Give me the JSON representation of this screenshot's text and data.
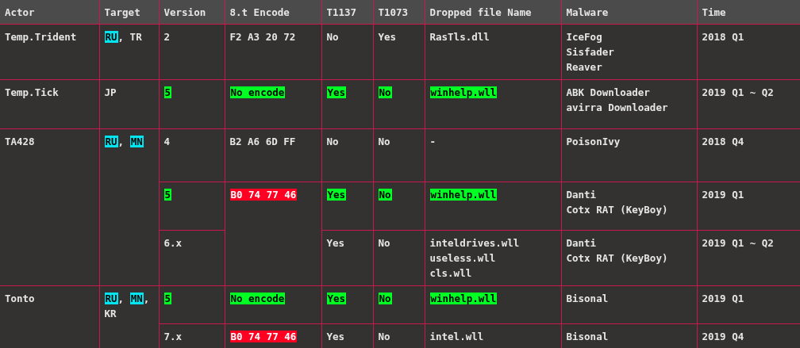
{
  "table": {
    "columns": [
      "Actor",
      "Target",
      "Version",
      "8.t Encode",
      "T1137",
      "T1073",
      "Dropped file Name",
      "Malware",
      "Time"
    ],
    "rows": [
      {
        "cells": [
          {
            "lines": [
              "Temp.Trident"
            ]
          },
          {
            "parts": [
              {
                "text": "RU",
                "color": "#00e5f0"
              },
              {
                "text": ", TR"
              }
            ]
          },
          {
            "lines": [
              "2"
            ]
          },
          {
            "lines": [
              "F2 A3 20 72"
            ]
          },
          {
            "lines": [
              "No"
            ]
          },
          {
            "lines": [
              "Yes"
            ]
          },
          {
            "lines": [
              "RasTls.dll"
            ]
          },
          {
            "lines": [
              "IceFog",
              "Sisfader",
              "Reaver"
            ]
          },
          {
            "lines": [
              "2018 Q1"
            ]
          }
        ]
      },
      {
        "cells": [
          {
            "lines": [
              "Temp.Tick"
            ]
          },
          {
            "lines": [
              "JP"
            ]
          },
          {
            "lines": [
              "5"
            ],
            "color": "#00ff22"
          },
          {
            "lines": [
              "No encode"
            ],
            "color": "#00ff22"
          },
          {
            "lines": [
              "Yes"
            ],
            "color": "#00ff22"
          },
          {
            "lines": [
              "No"
            ],
            "color": "#00ff22"
          },
          {
            "lines": [
              "winhelp.wll"
            ],
            "color": "#00ff22"
          },
          {
            "lines": [
              "ABK Downloader",
              "avirra Downloader"
            ]
          },
          {
            "lines": [
              "2019 Q1 ~ Q2"
            ]
          }
        ]
      },
      {
        "cells": [
          {
            "lines": [
              "TA428"
            ],
            "rowspan": 3
          },
          {
            "parts": [
              {
                "text": "RU",
                "color": "#00e5f0"
              },
              {
                "text": ", "
              },
              {
                "text": "MN",
                "color": "#00e5f0"
              }
            ],
            "rowspan": 3
          },
          {
            "lines": [
              "4"
            ]
          },
          {
            "lines": [
              "B2 A6 6D FF"
            ]
          },
          {
            "lines": [
              "No"
            ]
          },
          {
            "lines": [
              "No"
            ]
          },
          {
            "lines": [
              "-"
            ]
          },
          {
            "lines": [
              "PoisonIvy"
            ]
          },
          {
            "lines": [
              "2018 Q4"
            ]
          }
        ]
      },
      {
        "cells": [
          {
            "lines": [
              "5"
            ],
            "color": "#00ff22"
          },
          {
            "lines": [
              "B0 74 77 46"
            ],
            "color": "#ff0022",
            "rowspan": 2
          },
          {
            "lines": [
              "Yes"
            ],
            "color": "#00ff22"
          },
          {
            "lines": [
              "No"
            ],
            "color": "#00ff22"
          },
          {
            "lines": [
              "winhelp.wll"
            ],
            "color": "#00ff22"
          },
          {
            "lines": [
              "Danti",
              "Cotx RAT (KeyBoy)"
            ]
          },
          {
            "lines": [
              "2019 Q1"
            ]
          }
        ]
      },
      {
        "cells": [
          {
            "lines": [
              "6.x"
            ]
          },
          {
            "lines": [
              "Yes"
            ]
          },
          {
            "lines": [
              "No"
            ]
          },
          {
            "lines": [
              "inteldrives.wll",
              "useless.wll",
              "cls.wll"
            ]
          },
          {
            "lines": [
              "Danti",
              "Cotx RAT (KeyBoy)"
            ]
          },
          {
            "lines": [
              "2019 Q1 ~ Q2"
            ]
          }
        ]
      },
      {
        "cells": [
          {
            "lines": [
              "Tonto"
            ],
            "rowspan": 2
          },
          {
            "parts": [
              {
                "text": "RU",
                "color": "#00e5f0"
              },
              {
                "text": ", "
              },
              {
                "text": "MN",
                "color": "#00e5f0"
              },
              {
                "text": ","
              }
            ],
            "lines": [
              "KR"
            ],
            "rowspan": 2
          },
          {
            "lines": [
              "5"
            ],
            "color": "#00ff22"
          },
          {
            "lines": [
              "No encode"
            ],
            "color": "#00ff22"
          },
          {
            "lines": [
              "Yes"
            ],
            "color": "#00ff22"
          },
          {
            "lines": [
              "No"
            ],
            "color": "#00ff22"
          },
          {
            "lines": [
              "winhelp.wll"
            ],
            "color": "#00ff22"
          },
          {
            "lines": [
              "Bisonal"
            ]
          },
          {
            "lines": [
              "2019 Q1"
            ]
          }
        ]
      },
      {
        "cells": [
          {
            "lines": [
              "7.x"
            ]
          },
          {
            "lines": [
              "B0 74 77 46"
            ],
            "color": "#ff0022"
          },
          {
            "lines": [
              "Yes"
            ]
          },
          {
            "lines": [
              "No"
            ]
          },
          {
            "lines": [
              "intel.wll"
            ]
          },
          {
            "lines": [
              "Bisonal"
            ]
          },
          {
            "lines": [
              "2019 Q4"
            ]
          }
        ]
      }
    ]
  }
}
